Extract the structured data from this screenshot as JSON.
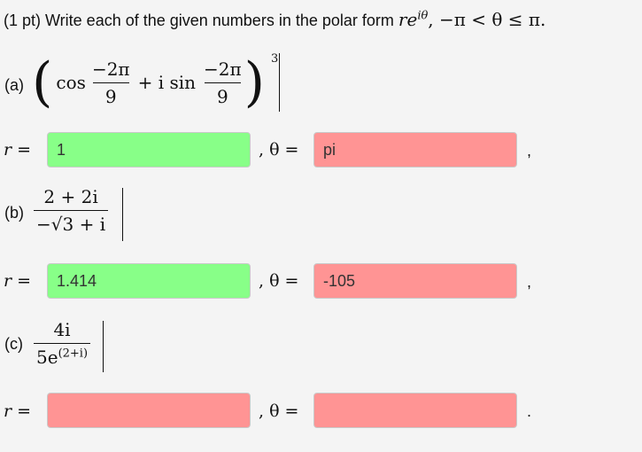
{
  "question": {
    "prefix": "(1 pt) Write each of the given numbers in the polar form",
    "form_math": "re",
    "form_exp": "iθ",
    "constraint": ", −π < θ ≤ π."
  },
  "parts": [
    {
      "label": "(a)",
      "expr": {
        "cos": "cos",
        "plus_i_sin": "+ i sin",
        "num": "−2π",
        "den": "9",
        "power": "3"
      },
      "r_label": "r =",
      "theta_label": ", θ =",
      "r_value": "1",
      "theta_value": "pi",
      "trailing": ","
    },
    {
      "label": "(b)",
      "expr": {
        "num": "2 + 2i",
        "den": "−√3 + i"
      },
      "r_label": "r =",
      "theta_label": ", θ =",
      "r_value": "1.414",
      "theta_value": "-105",
      "trailing": ","
    },
    {
      "label": "(c)",
      "expr": {
        "num": "4i",
        "den_base": "5e",
        "den_exp": "(2+i)"
      },
      "r_label": "r =",
      "theta_label": ", θ =",
      "r_value": "",
      "theta_value": "",
      "trailing": "."
    }
  ],
  "status_colors": {
    "correct": "#88ff88",
    "incorrect": "#ff9494"
  }
}
